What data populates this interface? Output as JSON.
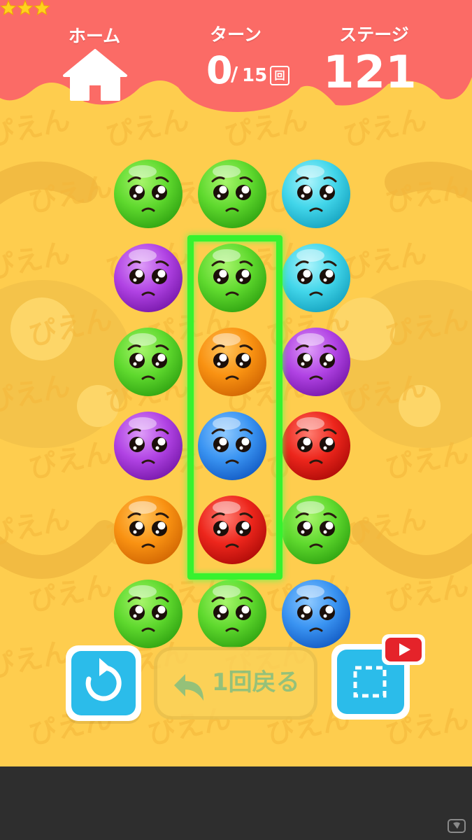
{
  "header": {
    "home_label": "ホーム",
    "turn_label": "ターン",
    "turn_current": "0",
    "turn_separator": "/",
    "turn_max": "15",
    "turn_unit": "回",
    "stars_earned": 3,
    "stage_label": "ステージ",
    "stage_number": "121"
  },
  "background": {
    "pattern_text": "ぴえん"
  },
  "board": {
    "columns": 3,
    "rows": 6,
    "cells": [
      [
        "green",
        "green",
        "cyan"
      ],
      [
        "purple",
        "green",
        "cyan"
      ],
      [
        "green",
        "orange",
        "purple"
      ],
      [
        "purple",
        "blue",
        "red"
      ],
      [
        "orange",
        "red",
        "green"
      ],
      [
        "green",
        "green",
        "blue"
      ]
    ],
    "selection": {
      "column": 1,
      "row_start": 1,
      "row_end": 4
    }
  },
  "controls": {
    "restart_icon": "restart-icon",
    "undo_label": "1回戻る",
    "undo_icon": "undo-arrow-icon",
    "screenshot_icon": "dashed-square-icon",
    "video_badge_icon": "play-icon"
  },
  "colors": {
    "header": "#fb6b66",
    "background": "#fecd4e",
    "selection": "#37f22e",
    "button_blue": "#2bbcea",
    "green": "#62e03a",
    "cyan": "#46dcee",
    "purple": "#b446e6",
    "orange": "#fb9a16",
    "blue": "#3a9af5",
    "red": "#f02a1e"
  }
}
